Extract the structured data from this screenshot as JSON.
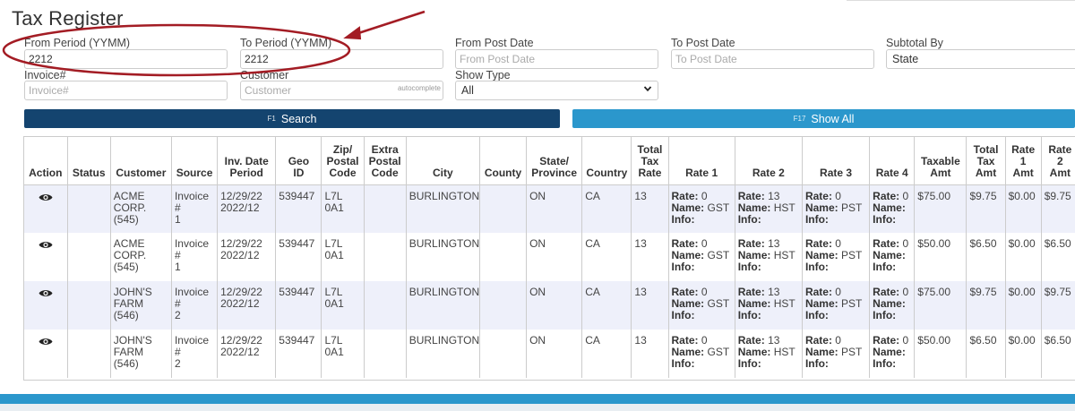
{
  "page_title": "Tax Register",
  "form": {
    "from_period": {
      "label": "From Period (YYMM)",
      "value": "2212"
    },
    "to_period": {
      "label": "To Period (YYMM)",
      "value": "2212"
    },
    "from_post_date": {
      "label": "From Post Date",
      "placeholder": "From Post Date"
    },
    "to_post_date": {
      "label": "To Post Date",
      "placeholder": "To Post Date"
    },
    "subtotal_by": {
      "label": "Subtotal By",
      "value": "State"
    },
    "invoice": {
      "label": "Invoice#",
      "placeholder": "Invoice#"
    },
    "customer": {
      "label": "Customer",
      "placeholder": "Customer",
      "tag": "autocomplete"
    },
    "show_type": {
      "label": "Show Type",
      "value": "All"
    }
  },
  "buttons": {
    "search": {
      "key": "F1",
      "label": "Search"
    },
    "show_all": {
      "key": "F17",
      "label": "Show All"
    }
  },
  "table": {
    "headers": {
      "action": "Action",
      "status": "Status",
      "customer": "Customer",
      "source": "Source",
      "inv_date_1": "Inv. Date",
      "inv_date_2": "Period",
      "geo_1": "Geo",
      "geo_2": "ID",
      "zip_1": "Zip/",
      "zip_2": "Postal",
      "zip_3": "Code",
      "extra_1": "Extra",
      "extra_2": "Postal",
      "extra_3": "Code",
      "city": "City",
      "county": "County",
      "state_1": "State/",
      "state_2": "Province",
      "country": "Country",
      "tr_1": "Total",
      "tr_2": "Tax",
      "tr_3": "Rate",
      "rate1": "Rate 1",
      "rate2": "Rate 2",
      "rate3": "Rate 3",
      "rate4": "Rate 4",
      "taxable_1": "Taxable",
      "taxable_2": "Amt",
      "tt_1": "Total",
      "tt_2": "Tax",
      "tt_3": "Amt",
      "r1a_1": "Rate",
      "r1a_2": "1",
      "r1a_3": "Amt",
      "r2a_1": "Rate",
      "r2a_2": "2",
      "r2a_3": "Amt"
    },
    "rate_labels": {
      "rate": "Rate:",
      "name": "Name:",
      "info": "Info:"
    },
    "rows": [
      {
        "cust_1": "ACME",
        "cust_2": "CORP.",
        "cust_3": "(545)",
        "src_1": "Invoice",
        "src_2": "#",
        "src_3": "1",
        "date": "12/29/22",
        "period": "2022/12",
        "geo": "539447",
        "zip_1": "L7L",
        "zip_2": "0A1",
        "extra": "",
        "city": "BURLINGTON",
        "county": "",
        "state": "ON",
        "country": "CA",
        "total_rate": "13",
        "r1_rate": "0",
        "r1_name": "GST",
        "r2_rate": "13",
        "r2_name": "HST",
        "r3_rate": "0",
        "r3_name": "PST",
        "r4_rate": "0",
        "taxable": "$75.00",
        "total_tax": "$9.75",
        "rate1_amt": "$0.00",
        "rate2_amt": "$9.75"
      },
      {
        "cust_1": "ACME",
        "cust_2": "CORP.",
        "cust_3": "(545)",
        "src_1": "Invoice",
        "src_2": "#",
        "src_3": "1",
        "date": "12/29/22",
        "period": "2022/12",
        "geo": "539447",
        "zip_1": "L7L",
        "zip_2": "0A1",
        "extra": "",
        "city": "BURLINGTON",
        "county": "",
        "state": "ON",
        "country": "CA",
        "total_rate": "13",
        "r1_rate": "0",
        "r1_name": "GST",
        "r2_rate": "13",
        "r2_name": "HST",
        "r3_rate": "0",
        "r3_name": "PST",
        "r4_rate": "0",
        "taxable": "$50.00",
        "total_tax": "$6.50",
        "rate1_amt": "$0.00",
        "rate2_amt": "$6.50"
      },
      {
        "cust_1": "JOHN'S",
        "cust_2": "FARM",
        "cust_3": "(546)",
        "src_1": "Invoice",
        "src_2": "#",
        "src_3": "2",
        "date": "12/29/22",
        "period": "2022/12",
        "geo": "539447",
        "zip_1": "L7L",
        "zip_2": "0A1",
        "extra": "",
        "city": "BURLINGTON",
        "county": "",
        "state": "ON",
        "country": "CA",
        "total_rate": "13",
        "r1_rate": "0",
        "r1_name": "GST",
        "r2_rate": "13",
        "r2_name": "HST",
        "r3_rate": "0",
        "r3_name": "PST",
        "r4_rate": "0",
        "taxable": "$75.00",
        "total_tax": "$9.75",
        "rate1_amt": "$0.00",
        "rate2_amt": "$9.75"
      },
      {
        "cust_1": "JOHN'S",
        "cust_2": "FARM",
        "cust_3": "(546)",
        "src_1": "Invoice",
        "src_2": "#",
        "src_3": "2",
        "date": "12/29/22",
        "period": "2022/12",
        "geo": "539447",
        "zip_1": "L7L",
        "zip_2": "0A1",
        "extra": "",
        "city": "BURLINGTON",
        "county": "",
        "state": "ON",
        "country": "CA",
        "total_rate": "13",
        "r1_rate": "0",
        "r1_name": "GST",
        "r2_rate": "13",
        "r2_name": "HST",
        "r3_rate": "0",
        "r3_name": "PST",
        "r4_rate": "0",
        "taxable": "$50.00",
        "total_tax": "$6.50",
        "rate1_amt": "$0.00",
        "rate2_amt": "$6.50"
      }
    ]
  },
  "icons": {
    "view": "eye-icon"
  },
  "colors": {
    "search_button": "#14446f",
    "show_all_button": "#2b97cc",
    "annotation": "#a31c24",
    "row_alt": "#eef0fa",
    "footer_bar": "#2b97cc"
  }
}
